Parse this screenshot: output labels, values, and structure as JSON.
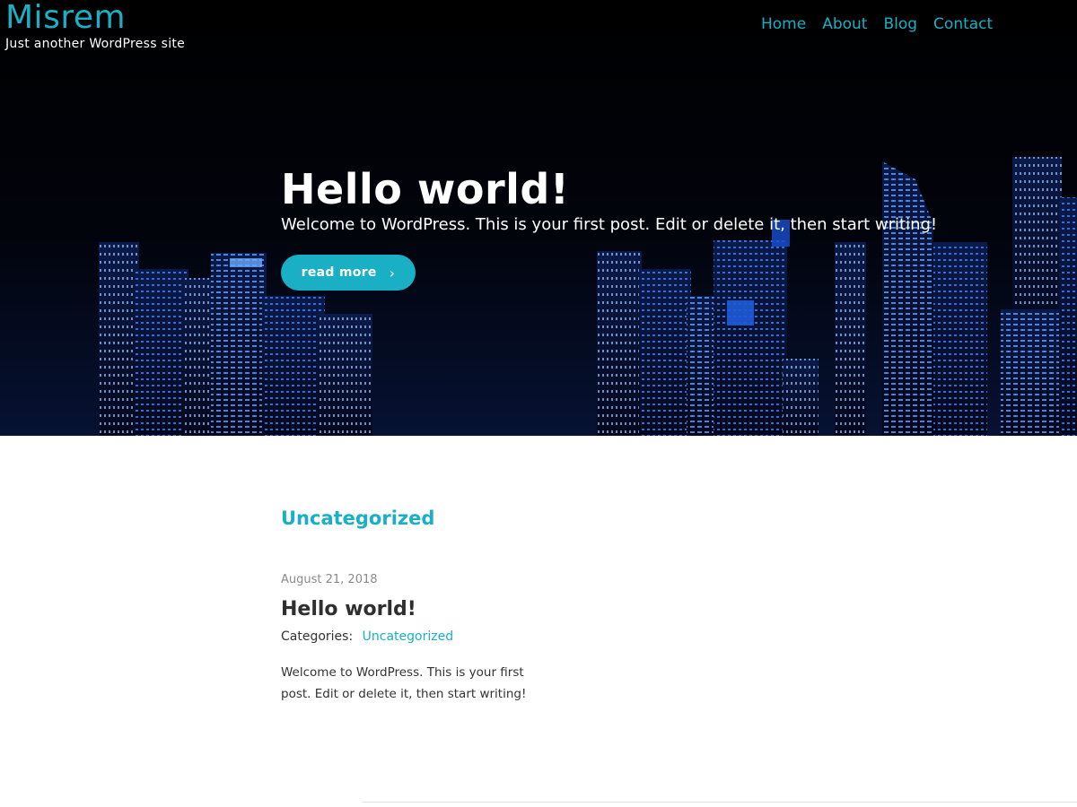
{
  "site": {
    "title": "Misrem",
    "tagline": "Just another WordPress site"
  },
  "nav": {
    "items": [
      "Home",
      "About",
      "Blog",
      "Contact"
    ]
  },
  "hero": {
    "title": "Hello world!",
    "excerpt": "Welcome to WordPress. This is your first post. Edit or delete it, then start writing!",
    "button_label": "read more",
    "button_icon": "chevron-right-icon"
  },
  "content": {
    "category_heading": "Uncategorized",
    "post": {
      "date": "August 21, 2018",
      "title": "Hello world!",
      "categories_label": "Categories:",
      "category": "Uncategorized",
      "excerpt": "Welcome to WordPress. This is your first post. Edit or delete it, then start writing!"
    }
  },
  "colors": {
    "accent": "#19afc4",
    "hero_bg": "#000000",
    "text": "#333333"
  }
}
